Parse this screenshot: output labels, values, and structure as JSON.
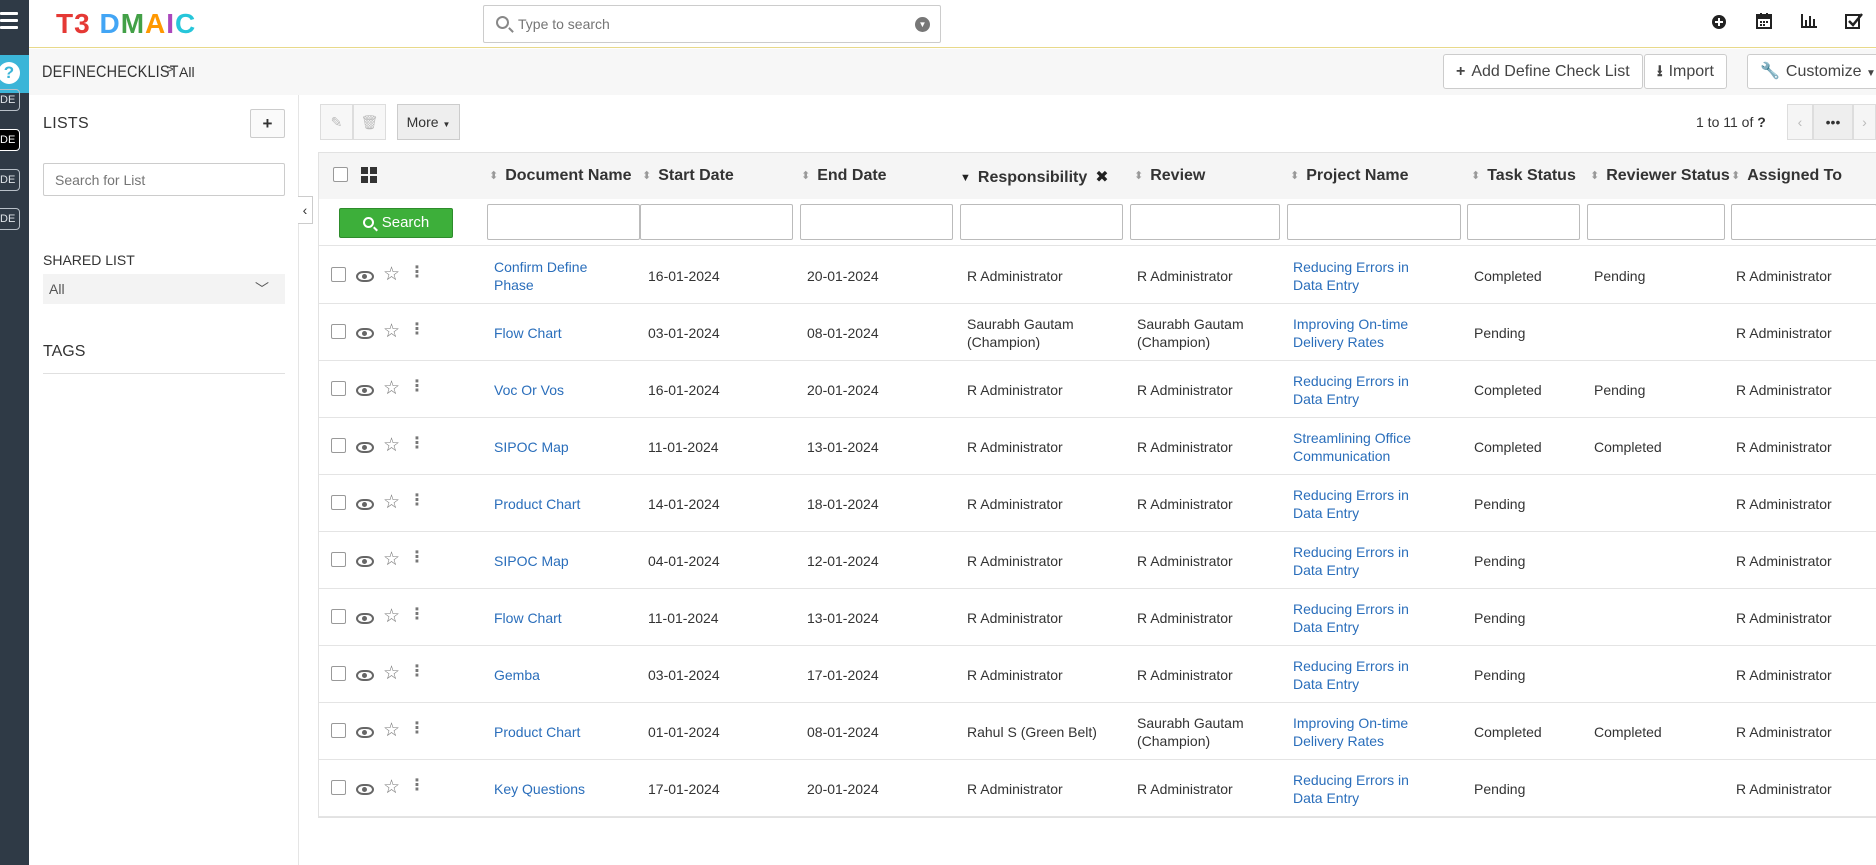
{
  "app": {
    "logo": "T3 DMAIC",
    "search_placeholder": "Type to search",
    "top_icons": [
      "plus-circle-icon",
      "calendar-icon",
      "bar-chart-icon",
      "checkbox-icon"
    ]
  },
  "rail": {
    "chips": [
      "DE",
      "DE",
      "DE",
      "DE"
    ]
  },
  "breadcrumb": {
    "title": "DEFINECHECKLIST",
    "separator": ">",
    "current": "All"
  },
  "header_actions": {
    "add_label": "Add Define Check List",
    "import_label": "Import",
    "customize_label": "Customize"
  },
  "lists_panel": {
    "title": "LISTS",
    "add_label": "+",
    "search_placeholder": "Search for List",
    "shared_title": "SHARED LIST",
    "shared_value": "All",
    "tags_title": "TAGS"
  },
  "toolbar": {
    "more_label": "More",
    "pager_text": "1 to 11  of ",
    "pager_total": "?",
    "pager_more": "•••"
  },
  "table": {
    "search_label": "Search",
    "columns": {
      "document_name": "Document Name",
      "start_date": "Start Date",
      "end_date": "End Date",
      "responsibility": "Responsibility",
      "review": "Review",
      "project_name": "Project Name",
      "task_status": "Task Status",
      "reviewer_status": "Reviewer Status",
      "assigned_to": "Assigned To"
    },
    "rows": [
      {
        "doc1": "Confirm Define",
        "doc2": "Phase",
        "start": "16-01-2024",
        "end": "20-01-2024",
        "resp1": "R Administrator",
        "resp2": "",
        "rev1": "R Administrator",
        "rev2": "",
        "proj1": "Reducing Errors in",
        "proj2": "Data Entry",
        "task": "Completed",
        "reviewer": "Pending",
        "assigned": "R Administrator"
      },
      {
        "doc1": "Flow Chart",
        "doc2": "",
        "start": "03-01-2024",
        "end": "08-01-2024",
        "resp1": "Saurabh Gautam",
        "resp2": "(Champion)",
        "rev1": "Saurabh Gautam",
        "rev2": "(Champion)",
        "proj1": "Improving On-time",
        "proj2": "Delivery Rates",
        "task": "Pending",
        "reviewer": "",
        "assigned": "R Administrator"
      },
      {
        "doc1": "Voc Or Vos",
        "doc2": "",
        "start": "16-01-2024",
        "end": "20-01-2024",
        "resp1": "R Administrator",
        "resp2": "",
        "rev1": "R Administrator",
        "rev2": "",
        "proj1": "Reducing Errors in",
        "proj2": "Data Entry",
        "task": "Completed",
        "reviewer": "Pending",
        "assigned": "R Administrator"
      },
      {
        "doc1": "SIPOC Map",
        "doc2": "",
        "start": "11-01-2024",
        "end": "13-01-2024",
        "resp1": "R Administrator",
        "resp2": "",
        "rev1": "R Administrator",
        "rev2": "",
        "proj1": "Streamlining Office",
        "proj2": "Communication",
        "task": "Completed",
        "reviewer": "Completed",
        "assigned": "R Administrator"
      },
      {
        "doc1": "Product Chart",
        "doc2": "",
        "start": "14-01-2024",
        "end": "18-01-2024",
        "resp1": "R Administrator",
        "resp2": "",
        "rev1": "R Administrator",
        "rev2": "",
        "proj1": "Reducing Errors in",
        "proj2": "Data Entry",
        "task": "Pending",
        "reviewer": "",
        "assigned": "R Administrator"
      },
      {
        "doc1": "SIPOC Map",
        "doc2": "",
        "start": "04-01-2024",
        "end": "12-01-2024",
        "resp1": "R Administrator",
        "resp2": "",
        "rev1": "R Administrator",
        "rev2": "",
        "proj1": "Reducing Errors in",
        "proj2": "Data Entry",
        "task": "Pending",
        "reviewer": "",
        "assigned": "R Administrator"
      },
      {
        "doc1": "Flow Chart",
        "doc2": "",
        "start": "11-01-2024",
        "end": "13-01-2024",
        "resp1": "R Administrator",
        "resp2": "",
        "rev1": "R Administrator",
        "rev2": "",
        "proj1": "Reducing Errors in",
        "proj2": "Data Entry",
        "task": "Pending",
        "reviewer": "",
        "assigned": "R Administrator"
      },
      {
        "doc1": "Gemba",
        "doc2": "",
        "start": "03-01-2024",
        "end": "17-01-2024",
        "resp1": "R Administrator",
        "resp2": "",
        "rev1": "R Administrator",
        "rev2": "",
        "proj1": "Reducing Errors in",
        "proj2": "Data Entry",
        "task": "Pending",
        "reviewer": "",
        "assigned": "R Administrator"
      },
      {
        "doc1": "Product Chart",
        "doc2": "",
        "start": "01-01-2024",
        "end": "08-01-2024",
        "resp1": "Rahul S (Green Belt)",
        "resp2": "",
        "rev1": "Saurabh Gautam",
        "rev2": "(Champion)",
        "proj1": "Improving On-time",
        "proj2": "Delivery Rates",
        "task": "Completed",
        "reviewer": "Completed",
        "assigned": "R Administrator"
      },
      {
        "doc1": "Key Questions",
        "doc2": "",
        "start": "17-01-2024",
        "end": "20-01-2024",
        "resp1": "R Administrator",
        "resp2": "",
        "rev1": "R Administrator",
        "rev2": "",
        "proj1": "Reducing Errors in",
        "proj2": "Data Entry",
        "task": "Pending",
        "reviewer": "",
        "assigned": "R Administrator"
      }
    ]
  },
  "colors": {
    "rail": "#2f3a46",
    "help": "#3bb5d8",
    "link": "#2a6ebb",
    "search_button": "#3daf3a",
    "logo_t3": "#e53935",
    "logo_letters": [
      "#42a5f5",
      "#43a047",
      "#ff9800",
      "#ab47bc",
      "#26c6da"
    ]
  }
}
